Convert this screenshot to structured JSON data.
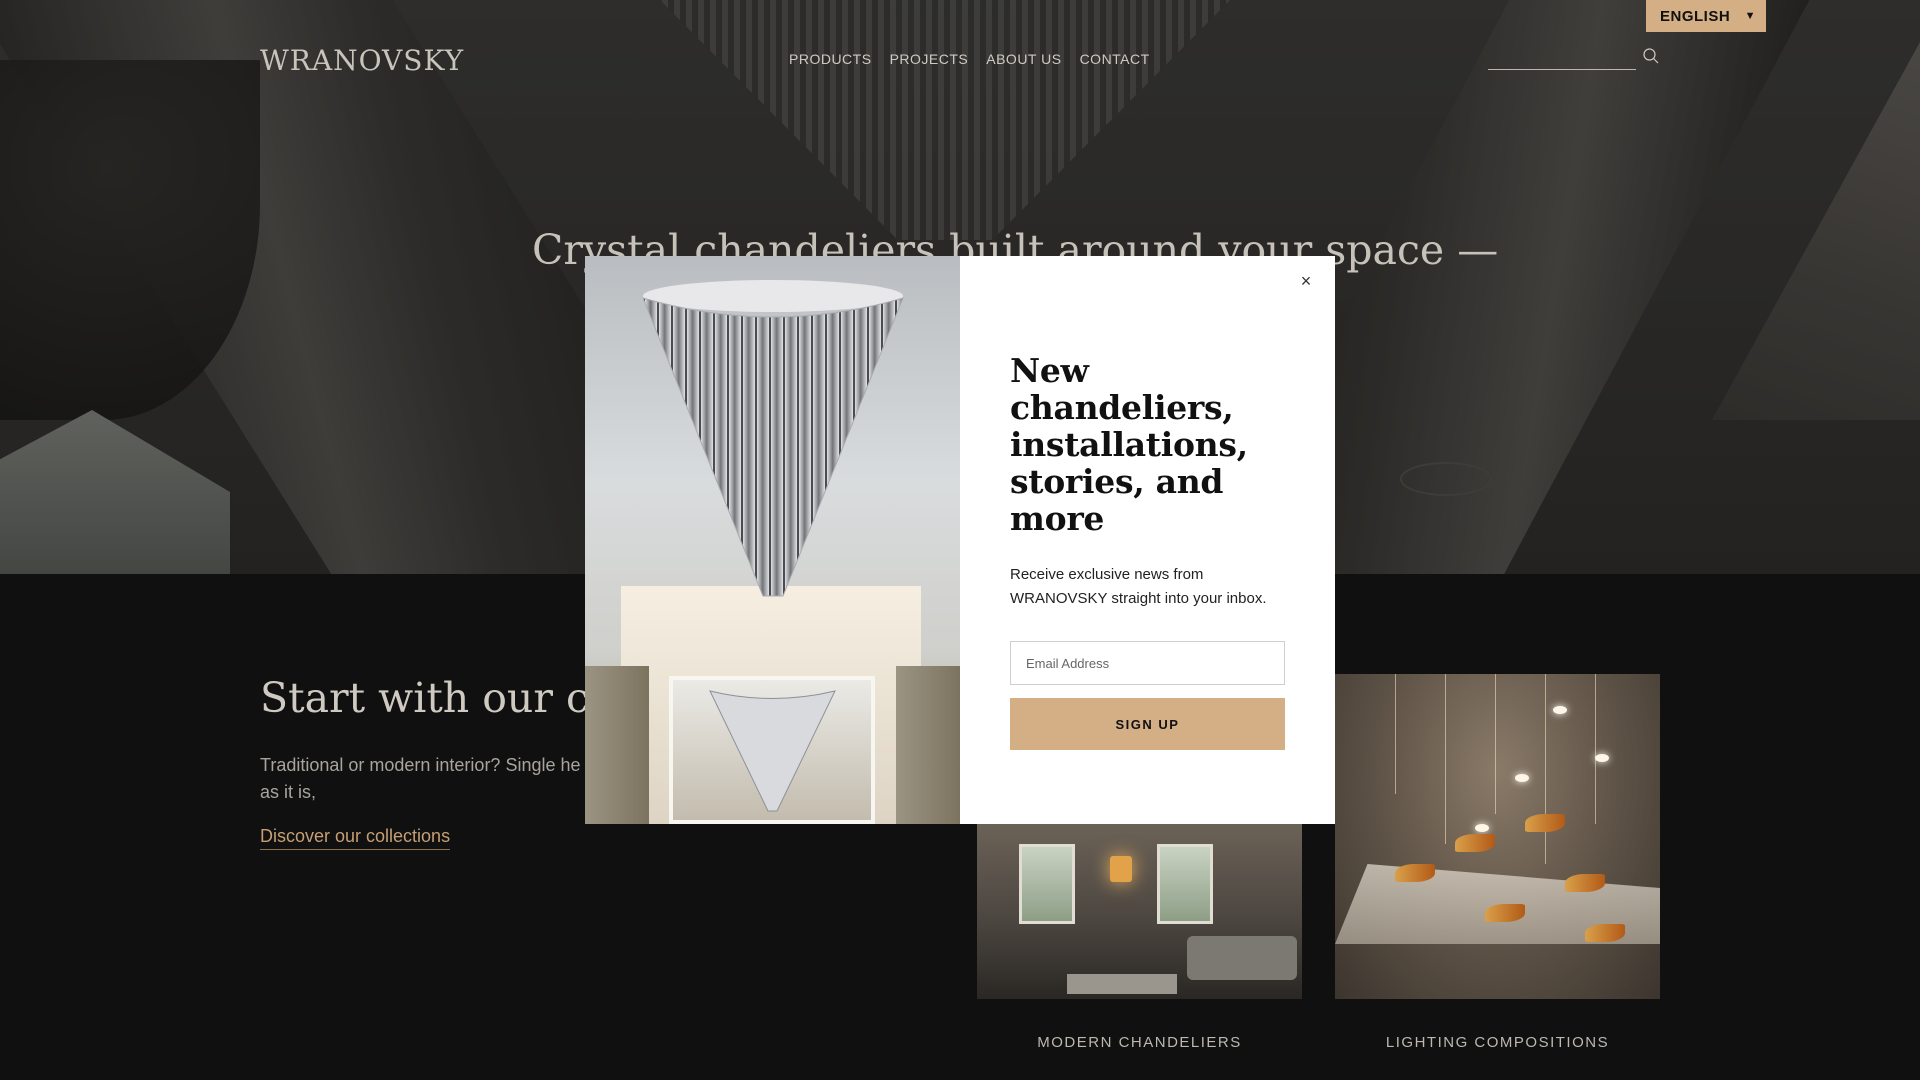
{
  "brand": {
    "logo": "WRANOVSKY"
  },
  "nav": {
    "items": [
      {
        "label": "PRODUCTS"
      },
      {
        "label": "PROJECTS"
      },
      {
        "label": "ABOUT US"
      },
      {
        "label": "CONTACT"
      }
    ]
  },
  "search": {
    "placeholder": ""
  },
  "language": {
    "selected": "ENGLISH"
  },
  "hero": {
    "title": "Crystal chandeliers built around your space —"
  },
  "collections": {
    "title": "Start with our col",
    "text": "Traditional or modern interior? Single he love, and we'll take it from there: as it is,",
    "link": "Discover our collections",
    "cards": [
      {
        "label": "MODERN CHANDELIERS"
      },
      {
        "label": "LIGHTING COMPOSITIONS"
      }
    ]
  },
  "modal": {
    "title": "New chandeliers, installations, stories, and more",
    "text": "Receive exclusive news from WRANOVSKY straight into your inbox.",
    "email_placeholder": "Email Address",
    "button": "SIGN UP",
    "close": "×"
  },
  "colors": {
    "accent": "#d4ae84",
    "link": "#c59f73",
    "background_dark": "#101010"
  }
}
